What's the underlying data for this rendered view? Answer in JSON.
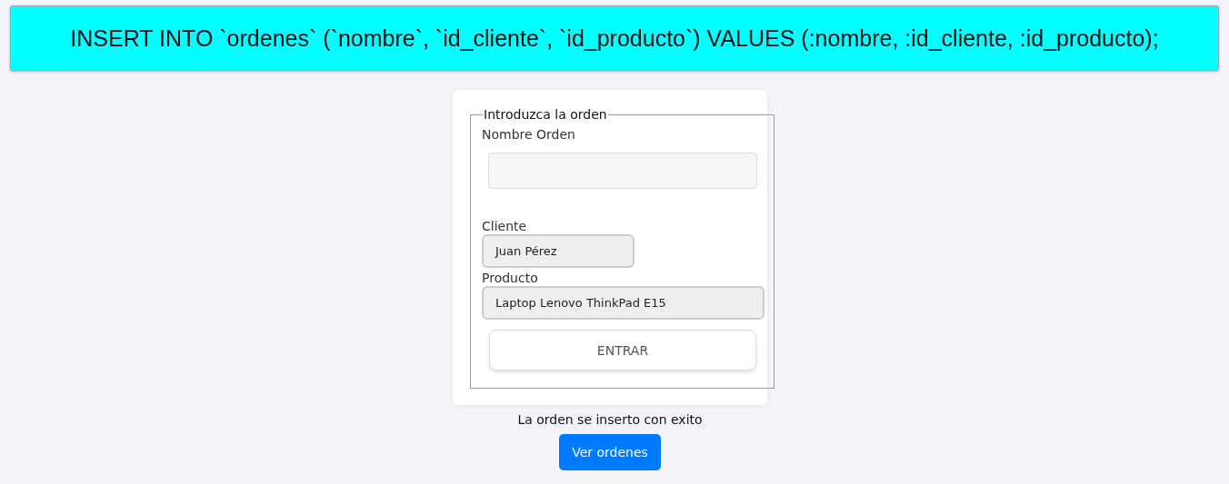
{
  "query_banner": "INSERT INTO `ordenes` (`nombre`, `id_cliente`, `id_producto`) VALUES (:nombre, :id_cliente, :id_producto);",
  "form": {
    "legend": "Introduzca la orden",
    "fields": [
      {
        "kind": "text",
        "label": "Nombre Orden"
      },
      {
        "kind": "select",
        "label": "Cliente",
        "value": "Juan Pérez"
      },
      {
        "kind": "select",
        "label": "Producto",
        "value": "Laptop Lenovo ThinkPad E15"
      }
    ],
    "submit": "ENTRAR"
  },
  "message": "La orden se inserto con exito",
  "view_button": "Ver ordenes"
}
